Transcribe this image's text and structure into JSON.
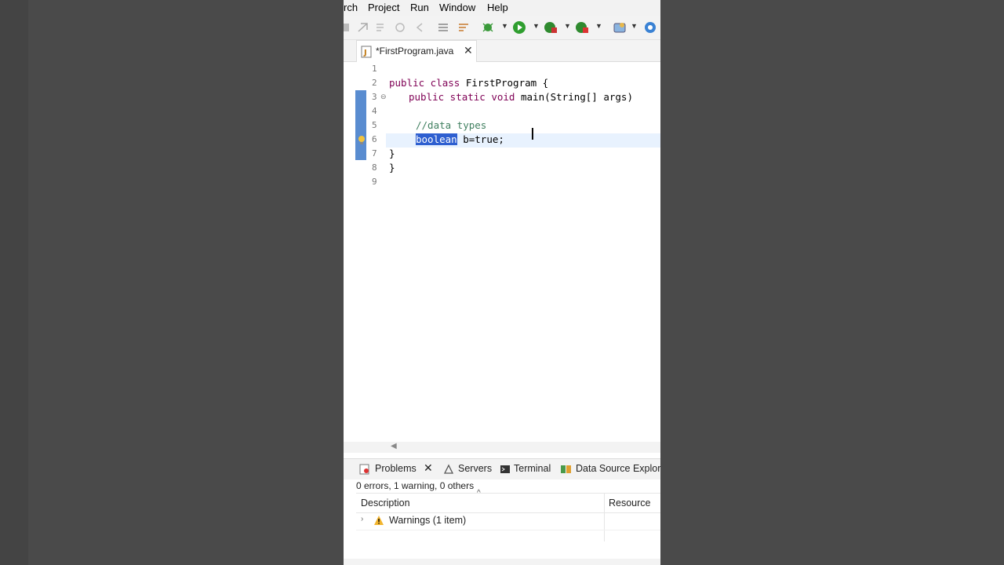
{
  "menu": [
    "rch",
    "Project",
    "Run",
    "Window",
    "Help"
  ],
  "editor": {
    "tab_label": "*FirstProgram.java",
    "line_numbers": [
      "1",
      "2",
      "3",
      "4",
      "5",
      "6",
      "7",
      "8",
      "9"
    ],
    "lines": {
      "l2_kw": "public class ",
      "l2_rest": "FirstProgram {",
      "l3_kw": "public static void ",
      "l3_rest": "main(String[] args)",
      "l5_comment": "//data types",
      "l6_selected": "boolean",
      "l6_rest": " b=true;",
      "l7": "}",
      "l8": "}"
    }
  },
  "panel": {
    "tabs": [
      "Problems",
      "Servers",
      "Terminal",
      "Data Source Explore"
    ],
    "summary": "0 errors, 1 warning, 0 others",
    "columns": [
      "Description",
      "Resource"
    ],
    "rows": [
      {
        "label": "Warnings (1 item)"
      }
    ]
  },
  "icons": [
    "new-icon",
    "run-icon",
    "debug-icon",
    "coverage-icon",
    "external-tools-icon",
    "java-file-icon",
    "warning-icon",
    "problems-icon",
    "servers-icon",
    "terminal-icon",
    "data-source-icon"
  ],
  "colors": {
    "keyword": "#7f0055",
    "comment": "#3f7f5f",
    "selection": "#2e5fd0",
    "ruler": "#3c78c8"
  }
}
